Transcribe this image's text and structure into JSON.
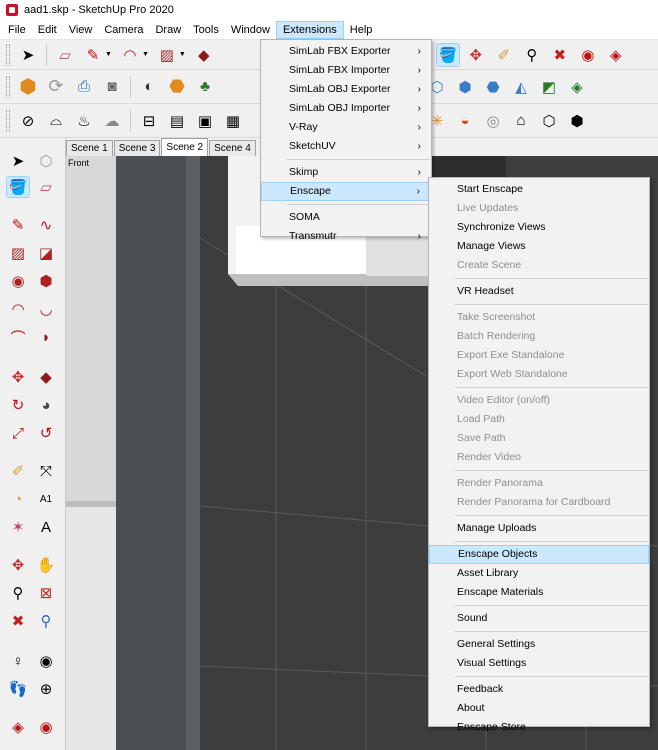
{
  "window": {
    "title": "aad1.skp - SketchUp Pro 2020"
  },
  "menubar": {
    "items": [
      "File",
      "Edit",
      "View",
      "Camera",
      "Draw",
      "Tools",
      "Window",
      "Extensions",
      "Help"
    ],
    "active": "Extensions"
  },
  "scenes": {
    "tabs": [
      "Scene 1",
      "Scene 3",
      "Scene 2",
      "Scene 4"
    ],
    "active": "Scene 2"
  },
  "viewport": {
    "label": "Front"
  },
  "extensions_menu": {
    "items": [
      {
        "label": "SimLab FBX Exporter",
        "submenu": true
      },
      {
        "label": "SimLab FBX Importer",
        "submenu": true
      },
      {
        "label": "SimLab OBJ Exporter",
        "submenu": true
      },
      {
        "label": "SimLab OBJ Importer",
        "submenu": true
      },
      {
        "label": "V-Ray",
        "submenu": true
      },
      {
        "label": "SketchUV",
        "submenu": true
      },
      {
        "label": "Skimp",
        "submenu": true
      },
      {
        "label": "Enscape",
        "submenu": true,
        "highlighted": true
      },
      {
        "label": "SOMA",
        "submenu": false
      },
      {
        "label": "Transmutr",
        "submenu": true
      }
    ]
  },
  "enscape_menu": {
    "groups": [
      [
        {
          "label": "Start Enscape",
          "enabled": true
        },
        {
          "label": "Live Updates",
          "enabled": false
        },
        {
          "label": "Synchronize Views",
          "enabled": true
        },
        {
          "label": "Manage Views",
          "enabled": true
        },
        {
          "label": "Create Scene",
          "enabled": false
        }
      ],
      [
        {
          "label": "VR Headset",
          "enabled": true
        }
      ],
      [
        {
          "label": "Take Screenshot",
          "enabled": false
        },
        {
          "label": "Batch Rendering",
          "enabled": false
        },
        {
          "label": "Export Exe Standalone",
          "enabled": false
        },
        {
          "label": "Export Web Standalone",
          "enabled": false
        }
      ],
      [
        {
          "label": "Video Editor (on/off)",
          "enabled": false
        },
        {
          "label": "Load Path",
          "enabled": false
        },
        {
          "label": "Save Path",
          "enabled": false
        },
        {
          "label": "Render Video",
          "enabled": false
        }
      ],
      [
        {
          "label": "Render Panorama",
          "enabled": false
        },
        {
          "label": "Render Panorama for Cardboard",
          "enabled": false
        }
      ],
      [
        {
          "label": "Manage Uploads",
          "enabled": true
        }
      ],
      [
        {
          "label": "Enscape Objects",
          "enabled": true,
          "highlighted": true
        },
        {
          "label": "Asset Library",
          "enabled": true
        },
        {
          "label": "Enscape Materials",
          "enabled": true
        }
      ],
      [
        {
          "label": "Sound",
          "enabled": true
        }
      ],
      [
        {
          "label": "General Settings",
          "enabled": true
        },
        {
          "label": "Visual Settings",
          "enabled": true
        }
      ],
      [
        {
          "label": "Feedback",
          "enabled": true
        },
        {
          "label": "About",
          "enabled": true
        },
        {
          "label": "Enscape Store",
          "enabled": true
        }
      ]
    ]
  },
  "colors": {
    "highlight": "#cce8ff",
    "highlight_border": "#99d1ff",
    "disabled_text": "#8e8e8e",
    "wall_tile": "#3a3a3a",
    "pillar": "#4d4d4d"
  }
}
